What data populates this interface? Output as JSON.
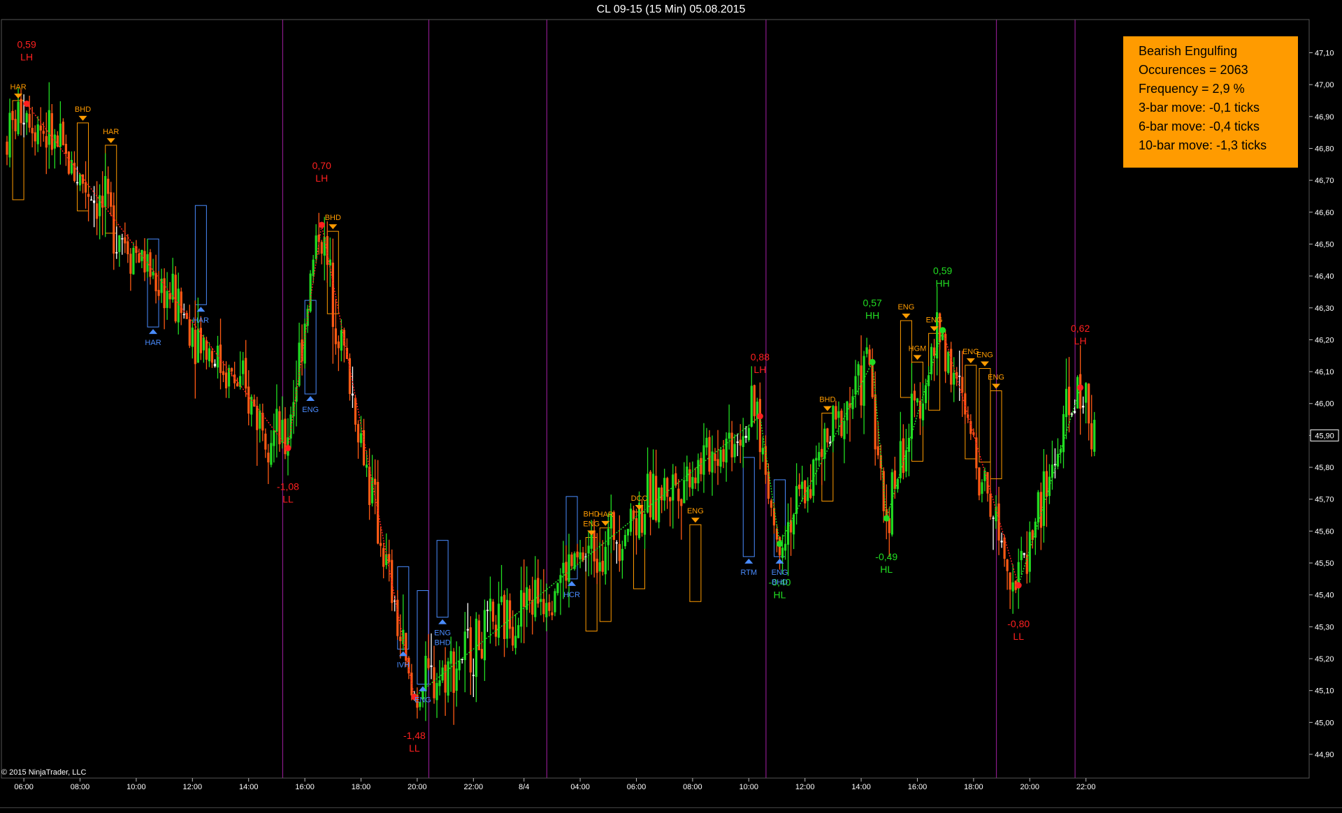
{
  "window": {
    "title": "CL 09-15 (15 Min)  05.08.2015"
  },
  "footer": {
    "copyright": "© 2015 NinjaTrader, LLC"
  },
  "info_box": {
    "lines": [
      "Bearish Engulfing",
      "Occurences = 2063",
      "Frequency = 2,9 %",
      "3-bar move: -0,1 ticks",
      "6-bar move: -0,4 ticks",
      "10-bar move: -1,3 ticks"
    ]
  },
  "colors": {
    "up_candle": "#22dd22",
    "down_candle": "#ff5a14",
    "doji": "#ffffff",
    "bear_zigzag": "#ff2020",
    "bull_zigzag": "#22dd22",
    "pattern_bear": "#ff9b00",
    "pattern_bull": "#4a8cff",
    "session_line": "#8b1a8b",
    "info_bg": "#ff9b00"
  },
  "chart_data": {
    "type": "candlestick",
    "title": "CL 09-15 (15 Min)  05.08.2015",
    "ylim": [
      44.8,
      47.2
    ],
    "y_ticks": [
      "44,90",
      "45,00",
      "45,10",
      "45,20",
      "45,30",
      "45,40",
      "45,50",
      "45,60",
      "45,70",
      "45,80",
      "45,90",
      "46,00",
      "46,10",
      "46,20",
      "46,30",
      "46,40",
      "46,50",
      "46,60",
      "46,70",
      "46,80",
      "46,90",
      "47,00",
      "47,10"
    ],
    "current_price_label": "45,90",
    "current_price": 45.9,
    "x_ticks": [
      "06:00",
      "08:00",
      "10:00",
      "12:00",
      "14:00",
      "16:00",
      "18:00",
      "20:00",
      "22:00",
      "8/4",
      "04:00",
      "06:00",
      "08:00",
      "10:00",
      "12:00",
      "14:00",
      "16:00",
      "18:00",
      "20:00",
      "22:00"
    ],
    "swing_points": [
      {
        "value": "0,59",
        "type": "LH",
        "price": 46.94,
        "bar": 7,
        "dir": "bear"
      },
      {
        "value": "-1,08",
        "type": "LL",
        "price": 45.86,
        "bar": 100,
        "dir": "bear"
      },
      {
        "value": "0,70",
        "type": "LH",
        "price": 46.56,
        "bar": 112,
        "dir": "bear"
      },
      {
        "value": "-1,48",
        "type": "LL",
        "price": 45.08,
        "bar": 145,
        "dir": "bear"
      },
      {
        "value": "0,88",
        "type": "LH",
        "price": 45.96,
        "bar": 268,
        "dir": "bear"
      },
      {
        "value": "-0,40",
        "type": "HL",
        "price": 45.56,
        "bar": 275,
        "dir": "bull"
      },
      {
        "value": "0,57",
        "type": "HH",
        "price": 46.13,
        "bar": 308,
        "dir": "bull"
      },
      {
        "value": "-0,49",
        "type": "HL",
        "price": 45.64,
        "bar": 313,
        "dir": "bull"
      },
      {
        "value": "0,59",
        "type": "HH",
        "price": 46.23,
        "bar": 333,
        "dir": "bull"
      },
      {
        "value": "-0,80",
        "type": "LL",
        "price": 45.43,
        "bar": 360,
        "dir": "bear"
      },
      {
        "value": "0,62",
        "type": "LH",
        "price": 46.05,
        "bar": 382,
        "dir": "bear"
      }
    ],
    "pattern_labels": [
      {
        "label": "HAR",
        "bar": 4,
        "price": 46.95,
        "side": "above",
        "dir": "bear"
      },
      {
        "label": "BHD",
        "bar": 27,
        "price": 46.88,
        "side": "above",
        "dir": "bear"
      },
      {
        "label": "HAR",
        "bar": 37,
        "price": 46.81,
        "side": "above",
        "dir": "bear"
      },
      {
        "label": "HAR",
        "bar": 52,
        "price": 46.24,
        "side": "below",
        "dir": "bull"
      },
      {
        "label": "HAR",
        "bar": 69,
        "price": 46.31,
        "side": "below",
        "dir": "bull"
      },
      {
        "label": "ENG",
        "bar": 108,
        "price": 46.03,
        "side": "below",
        "dir": "bull"
      },
      {
        "label": "BHD",
        "bar": 116,
        "price": 46.54,
        "side": "above",
        "dir": "bear"
      },
      {
        "label": "IVH",
        "bar": 141,
        "price": 45.23,
        "side": "below",
        "dir": "bull"
      },
      {
        "label": "ENG",
        "bar": 148,
        "price": 45.12,
        "side": "below",
        "dir": "bull"
      },
      {
        "label": "ENG",
        "bar": 155,
        "price": 45.33,
        "side": "below",
        "dir": "bull"
      },
      {
        "label": "BHD",
        "bar": 155,
        "price": 45.33,
        "side": "below2",
        "dir": "bull"
      },
      {
        "label": "HCR",
        "bar": 201,
        "price": 45.45,
        "side": "below",
        "dir": "bull"
      },
      {
        "label": "BHD",
        "bar": 208,
        "price": 45.58,
        "side": "above2",
        "dir": "bear"
      },
      {
        "label": "ENG",
        "bar": 208,
        "price": 45.58,
        "side": "above",
        "dir": "bear"
      },
      {
        "label": "HAR",
        "bar": 213,
        "price": 45.61,
        "side": "above",
        "dir": "bear"
      },
      {
        "label": "DCC",
        "bar": 225,
        "price": 45.66,
        "side": "above",
        "dir": "bear"
      },
      {
        "label": "ENG",
        "bar": 245,
        "price": 45.62,
        "side": "above",
        "dir": "bear"
      },
      {
        "label": "RTM",
        "bar": 264,
        "price": 45.52,
        "side": "below",
        "dir": "bull"
      },
      {
        "label": "ENG",
        "bar": 275,
        "price": 45.52,
        "side": "below",
        "dir": "bull"
      },
      {
        "label": "BHD",
        "bar": 275,
        "price": 45.52,
        "side": "below2",
        "dir": "bull"
      },
      {
        "label": "BHD",
        "bar": 292,
        "price": 45.97,
        "side": "above",
        "dir": "bear"
      },
      {
        "label": "ENG",
        "bar": 320,
        "price": 46.26,
        "side": "above",
        "dir": "bear"
      },
      {
        "label": "HGM",
        "bar": 324,
        "price": 46.13,
        "side": "above",
        "dir": "bear"
      },
      {
        "label": "ENG",
        "bar": 330,
        "price": 46.22,
        "side": "above",
        "dir": "bear"
      },
      {
        "label": "ENG",
        "bar": 343,
        "price": 46.12,
        "side": "above",
        "dir": "bear"
      },
      {
        "label": "ENG",
        "bar": 348,
        "price": 46.11,
        "side": "above",
        "dir": "bear"
      },
      {
        "label": "ENG",
        "bar": 352,
        "price": 46.04,
        "side": "above",
        "dir": "bear"
      }
    ]
  }
}
